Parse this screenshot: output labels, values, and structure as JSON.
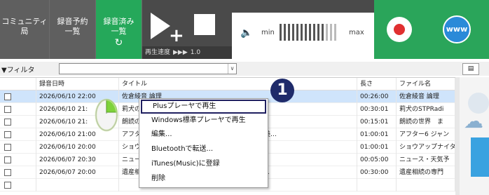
{
  "toolbar": {
    "community": {
      "line1": "コミュニティ",
      "line2": "局"
    },
    "reserve": {
      "line1": "録音予約",
      "line2": "一覧"
    },
    "recorded": {
      "line1": "録音済み",
      "line2": "一覧",
      "icon": "refresh-icon"
    },
    "player": {
      "speed_label": "再生速度",
      "speed_arrows": "▶▶▶",
      "speed_value": "1.0"
    },
    "volume": {
      "min_label": "min",
      "max_label": "max",
      "level": 0.7
    },
    "record": {
      "icon": "record-icon"
    },
    "web": {
      "label": "www"
    }
  },
  "filter": {
    "label": "フィルタ",
    "value": ""
  },
  "table": {
    "headers": {
      "date": "録音日時",
      "title": "タイトル",
      "length": "長さ",
      "file": "ファイル名"
    },
    "rows": [
      {
        "date": "2026/06/10 22:00",
        "title": "佐倉綾音 論理",
        "length": "00:26:00",
        "file": "佐倉綾音 論理",
        "selected": true
      },
      {
        "date": "2026/06/10 21:",
        "title": "莉犬のSTPRadio（すとぷり）",
        "length": "00:30:01",
        "file": "莉犬のSTPRadi",
        "selected": false
      },
      {
        "date": "2026/06/10 21:",
        "title": "朗読の世界　いちか",
        "length": "00:15:01",
        "file": "朗読の世界　ま",
        "selected": false
      },
      {
        "date": "2026/06/10 21:00",
        "title": "アフター6ジャンクション　ゲスト：宇多丸 / 宇垣美…",
        "length": "01:00:01",
        "file": "アフター6 ジャン",
        "selected": false
      },
      {
        "date": "2026/06/10 20:00",
        "title": "ショウアップナイター　解説：鉄平、実況：守屋周",
        "length": "01:00:01",
        "file": "ショウアップナイタ",
        "selected": false
      },
      {
        "date": "2026/06/07 20:30",
        "title": "ニュース・天気予報",
        "length": "00:05:00",
        "file": "ニュース・天気予",
        "selected": false
      },
      {
        "date": "2026/06/07 20:00",
        "title": "遺産相続の専門家　ゲスト：亜美 / 井上真之(NCP…",
        "length": "00:30:00",
        "file": "遺産相続の専門",
        "selected": false
      }
    ]
  },
  "context_menu": {
    "items": [
      "Plusプレーヤで再生",
      "Windows標準プレーヤで再生",
      "編集...",
      "Bluetoothで転送...",
      "iTunes(Music)に登録",
      "削除"
    ],
    "step_number": "1"
  },
  "colors": {
    "green": "#2aa55a",
    "dark": "#4a4a4a",
    "selection": "#cfe4fb",
    "badge": "#1f2b6a"
  }
}
